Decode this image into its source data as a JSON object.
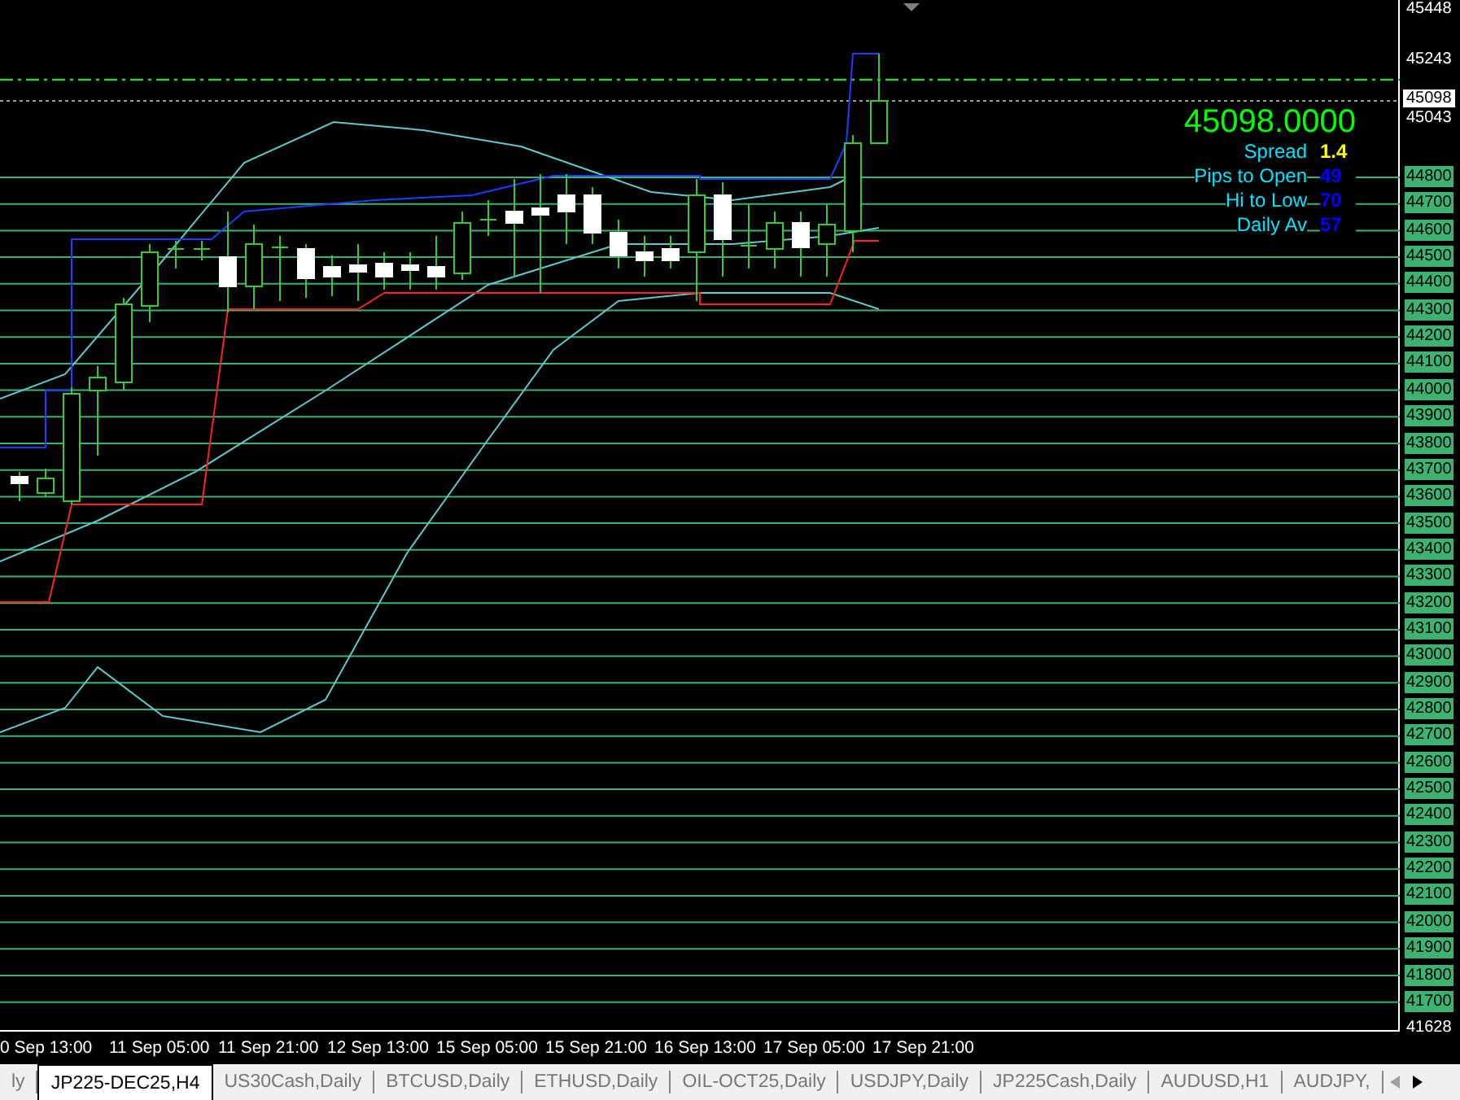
{
  "price_axis": {
    "level_labels": [
      "44800",
      "44700",
      "44600",
      "44500",
      "44400",
      "44300",
      "44200",
      "44100",
      "44000",
      "43900",
      "43800",
      "43700",
      "43600",
      "43500",
      "43400",
      "43300",
      "43200",
      "43100",
      "43000",
      "42900",
      "42800",
      "42700",
      "42600",
      "42500",
      "42400",
      "42300",
      "42200",
      "42100",
      "42000",
      "41900",
      "41800",
      "41700"
    ],
    "scale_labels": [
      "45448",
      "45243",
      "45043",
      "41628"
    ],
    "current_price": "45098"
  },
  "info_panel": {
    "price": "45098.0000",
    "rows": [
      {
        "label": "Spread",
        "value": "1.4",
        "color": "#ffff00"
      },
      {
        "label": "Pips to Open",
        "value": "49",
        "color": "#0000ff"
      },
      {
        "label": "Hi to Low",
        "value": "70",
        "color": "#0000ff"
      },
      {
        "label": "Daily Av",
        "value": "57",
        "color": "#0000ff"
      }
    ]
  },
  "time_axis": [
    "0 Sep 13:00",
    "11 Sep 05:00",
    "11 Sep 21:00",
    "12 Sep 13:00",
    "15 Sep 05:00",
    "15 Sep 21:00",
    "16 Sep 13:00",
    "17 Sep 05:00",
    "17 Sep 21:00"
  ],
  "tabs": [
    {
      "label": "ly",
      "selected": false
    },
    {
      "label": "JP225-DEC25,H4",
      "selected": true
    },
    {
      "label": "US30Cash,Daily",
      "selected": false
    },
    {
      "label": "BTCUSD,Daily",
      "selected": false
    },
    {
      "label": "ETHUSD,Daily",
      "selected": false
    },
    {
      "label": "OIL-OCT25,Daily",
      "selected": false
    },
    {
      "label": "USDJPY,Daily",
      "selected": false
    },
    {
      "label": "JP225Cash,Daily",
      "selected": false
    },
    {
      "label": "AUDUSD,H1",
      "selected": false
    },
    {
      "label": "AUDJPY,",
      "selected": false
    }
  ]
}
